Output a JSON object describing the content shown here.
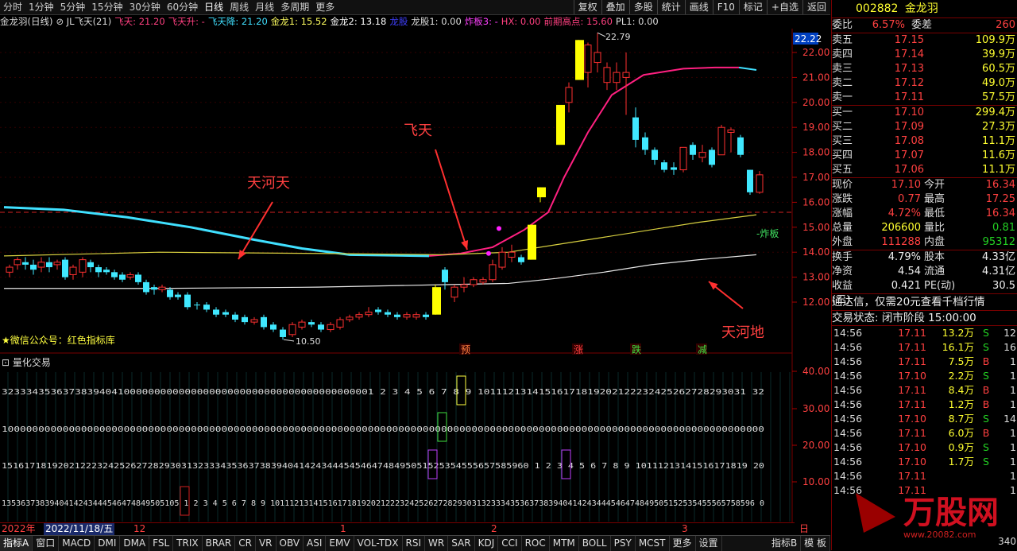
{
  "periods": [
    "分时",
    "1分钟",
    "5分钟",
    "15分钟",
    "30分钟",
    "60分钟",
    "日线",
    "周线",
    "月线",
    "多周期",
    "更多"
  ],
  "active_period": "日线",
  "tools": [
    "复权",
    "叠加",
    "多股",
    "统计",
    "画线",
    "F10",
    "标记",
    "+自选",
    "返回"
  ],
  "indicator_line": [
    {
      "text": "金龙羽(日线)",
      "color": "#dddddd"
    },
    {
      "text": "⊘ JL飞天(21)",
      "color": "#dddddd"
    },
    {
      "text": "飞天: 21.20",
      "color": "#ff4080"
    },
    {
      "text": "飞天升: -",
      "color": "#ff4080"
    },
    {
      "text": "飞天降: 21.20",
      "color": "#40e0ff"
    },
    {
      "text": "金龙1: 15.52",
      "color": "#ffff60"
    },
    {
      "text": "金龙2: 13.18",
      "color": "#ffffff"
    },
    {
      "text": "龙股",
      "color": "#4040ff"
    },
    {
      "text": "龙股1: 0.00",
      "color": "#dddddd"
    },
    {
      "text": "炸板3: -",
      "color": "#ff40ff"
    },
    {
      "text": "HX: 0.00",
      "color": "#ff4080"
    },
    {
      "text": "前期高点: 15.60",
      "color": "#ff4080"
    },
    {
      "text": "PL1: 0.00",
      "color": "#dddddd"
    }
  ],
  "annotations": {
    "tianhetian": "天河天",
    "feitian": "飞天",
    "tianhedi": "天河地",
    "zhaban": "-炸板",
    "high_label": "22.79",
    "low_label": "10.50",
    "wechat": "★微信公众号：红色指标库",
    "price_tag": "22.22",
    "signals": [
      "预",
      "涨",
      "跌",
      "减"
    ]
  },
  "price_axis": [
    "22.00",
    "21.00",
    "20.00",
    "19.00",
    "18.00",
    "17.00",
    "16.00",
    "15.00",
    "14.00",
    "13.00",
    "12.00"
  ],
  "sub_panel": {
    "title": "⊡ 量化交易",
    "axis": [
      "40.00",
      "30.00",
      "20.00",
      "10.00"
    ],
    "rows": [
      "3233343536373839404100000000000000000000000000000000000000001 2 3 4 5 6 7 8 9 10111213141516171819202122232425262728293031 32",
      "10000000000000000000000000000000000000000000000000000000000000000000000000000000000000000000000000000000000000000000000000000",
      "1516171819202122232425262728293031323334353637383940414243444545464748495051525354555657585960 1 2 3 4 5 6 7 8 9 10111213141516171819 20",
      "1353637383940414243444546474849505105 1 2 3 4 5 6 7 8 9 10111213141516171819202122232425262728293031323334353637383940414243444546474849505152535455565758596 0"
    ]
  },
  "date_axis": [
    "2022年",
    "2022/11/18/五",
    "12",
    "1",
    "2",
    "3",
    "日线"
  ],
  "bottom_tabs": [
    "指标A",
    "窗口",
    "MACD",
    "DMI",
    "DMA",
    "FSL",
    "TRIX",
    "BRAR",
    "CR",
    "VR",
    "OBV",
    "ASI",
    "EMV",
    "VOL-TDX",
    "RSI",
    "WR",
    "SAR",
    "KDJ",
    "CCI",
    "ROC",
    "MTM",
    "BOLL",
    "PSY",
    "MCST",
    "更多",
    "设置"
  ],
  "bottom_right_tabs": [
    "指标B",
    "模 板"
  ],
  "stock": {
    "code": "002882",
    "name": "金龙羽"
  },
  "quote": {
    "weibi_label": "委比",
    "weibi": "6.57%",
    "weicha_label": "委差",
    "weicha": "260",
    "asks": [
      {
        "label": "卖五",
        "price": "17.15",
        "vol": "109.9万"
      },
      {
        "label": "卖四",
        "price": "17.14",
        "vol": "39.9万"
      },
      {
        "label": "卖三",
        "price": "17.13",
        "vol": "60.5万"
      },
      {
        "label": "卖二",
        "price": "17.12",
        "vol": "49.0万"
      },
      {
        "label": "卖一",
        "price": "17.11",
        "vol": "57.5万"
      }
    ],
    "bids": [
      {
        "label": "买一",
        "price": "17.10",
        "vol": "299.4万"
      },
      {
        "label": "买二",
        "price": "17.09",
        "vol": "27.3万"
      },
      {
        "label": "买三",
        "price": "17.08",
        "vol": "11.1万"
      },
      {
        "label": "买四",
        "price": "17.07",
        "vol": "11.6万"
      },
      {
        "label": "买五",
        "price": "17.06",
        "vol": "11.1万"
      }
    ],
    "stats": [
      {
        "l1": "现价",
        "v1": "17.10",
        "l2": "今开",
        "v2": "16.34"
      },
      {
        "l1": "涨跌",
        "v1": "0.77",
        "l2": "最高",
        "v2": "17.25"
      },
      {
        "l1": "涨幅",
        "v1": "4.72%",
        "l2": "最低",
        "v2": "16.34"
      },
      {
        "l1": "总量",
        "v1": "206600",
        "l2": "量比",
        "v2": "0.81"
      },
      {
        "l1": "外盘",
        "v1": "111288",
        "l2": "内盘",
        "v2": "95312"
      }
    ],
    "stats2": [
      {
        "l1": "换手",
        "v1": "4.79%",
        "l2": "股本",
        "v2": "4.33亿"
      },
      {
        "l1": "净资",
        "v1": "4.54",
        "l2": "流通",
        "v2": "4.31亿"
      },
      {
        "l1": "收益(三)",
        "v1": "0.421",
        "l2": "PE(动)",
        "v2": "30.5"
      }
    ],
    "promo": "通达信，仅需20元查看千档行情",
    "status": "交易状态: 闭市阶段 15:00:00"
  },
  "trades": [
    {
      "t": "14:56",
      "p": "17.11",
      "v": "13.2万",
      "bs": "S",
      "n": "12"
    },
    {
      "t": "14:56",
      "p": "17.11",
      "v": "16.1万",
      "bs": "S",
      "n": "16"
    },
    {
      "t": "14:56",
      "p": "17.11",
      "v": "7.5万",
      "bs": "B",
      "n": "1"
    },
    {
      "t": "14:56",
      "p": "17.10",
      "v": "2.2万",
      "bs": "S",
      "n": "1"
    },
    {
      "t": "14:56",
      "p": "17.11",
      "v": "8.4万",
      "bs": "B",
      "n": "1"
    },
    {
      "t": "14:56",
      "p": "17.11",
      "v": "1.2万",
      "bs": "B",
      "n": "1"
    },
    {
      "t": "14:56",
      "p": "17.10",
      "v": "8.7万",
      "bs": "S",
      "n": "14"
    },
    {
      "t": "14:56",
      "p": "17.11",
      "v": "6.0万",
      "bs": "B",
      "n": "1"
    },
    {
      "t": "14:56",
      "p": "17.10",
      "v": "0.9万",
      "bs": "S",
      "n": "1"
    },
    {
      "t": "14:56",
      "p": "17.10",
      "v": "1.7万",
      "bs": "S",
      "n": "1"
    },
    {
      "t": "14:56",
      "p": "17.11",
      "v": "",
      "bs": "",
      "n": "1"
    },
    {
      "t": "14:56",
      "p": "17.11",
      "v": "",
      "bs": "",
      "n": "1"
    }
  ],
  "watermark": "万股网",
  "watermark_url": "www.20082.com",
  "bottom_right_num": "340"
}
